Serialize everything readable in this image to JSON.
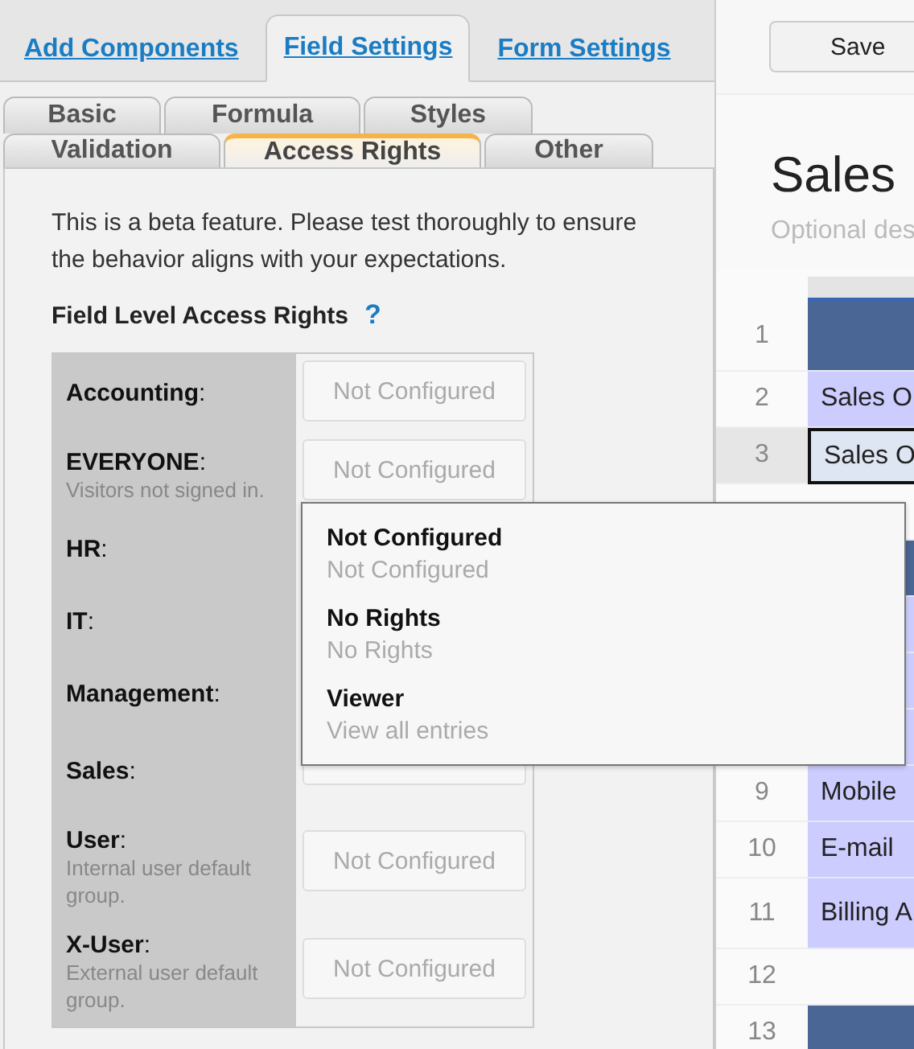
{
  "main_tabs": [
    {
      "label": "Add Components",
      "selected": false
    },
    {
      "label": "Field Settings",
      "selected": true
    },
    {
      "label": "Form Settings",
      "selected": false
    }
  ],
  "sub_tab_rows": [
    {
      "tabs": [
        {
          "label": "Basic",
          "selected": false
        },
        {
          "label": "Formula",
          "selected": false
        },
        {
          "label": "Styles",
          "selected": false
        }
      ]
    },
    {
      "tabs": [
        {
          "label": "Validation",
          "selected": false
        },
        {
          "label": "Access Rights",
          "selected": true
        },
        {
          "label": "Other",
          "selected": false
        }
      ]
    }
  ],
  "notice": "This is a beta feature. Please test thoroughly to ensure the behavior aligns with your expectations.",
  "section_title": "Field Level Access Rights",
  "help": "?",
  "groups": [
    {
      "label": "**Accounting**:",
      "value": "Not Configured"
    },
    {
      "label": "**EVERYONE**:",
      "description": "Visitors not signed in.",
      "value": "Not Configured"
    },
    {
      "label": "**HR**:"
    },
    {
      "label": "**IT**:"
    },
    {
      "label": "**Management**:"
    },
    {
      "label": "**Sales**:",
      "field_edge": true
    },
    {
      "label": "**User**:",
      "description": "Internal user default group.",
      "value": "Not Configured"
    },
    {
      "label": "**X-User**:",
      "description": "External user default group.",
      "value": "Not Configured"
    }
  ],
  "menu": {
    "options": [
      {
        "title": "Not Configured",
        "subtitle": "Not Configured"
      },
      {
        "title": "No Rights",
        "subtitle": "No Rights"
      },
      {
        "title": "Viewer",
        "subtitle": "View all entries"
      }
    ]
  },
  "toolbar": {
    "save": "Save"
  },
  "sheet": {
    "title": "Sales",
    "description_placeholder": "Optional des",
    "rows": [
      {
        "number": "1",
        "kind": "header",
        "selected": false
      },
      {
        "number": "2",
        "kind": "field",
        "text": "Sales O",
        "selected": false
      },
      {
        "number": "3",
        "kind": "field",
        "text": "Sales O",
        "selected": true
      },
      {
        "kind": "empty",
        "selected": false
      },
      {
        "kind": "header",
        "selected": false
      },
      {
        "kind": "field",
        "selected": false
      },
      {
        "kind": "field",
        "selected": false
      },
      {
        "kind": "field",
        "selected": false
      },
      {
        "number": "9",
        "kind": "field",
        "text": "Mobile",
        "selected": false
      },
      {
        "number": "10",
        "kind": "field",
        "text": "E-mail",
        "selected": false
      },
      {
        "number": "11",
        "kind": "field",
        "text": "Billing A",
        "selected": false,
        "tall": true
      },
      {
        "number": "12",
        "kind": "empty",
        "selected": false
      },
      {
        "number": "13",
        "kind": "header",
        "selected": false
      }
    ]
  }
}
